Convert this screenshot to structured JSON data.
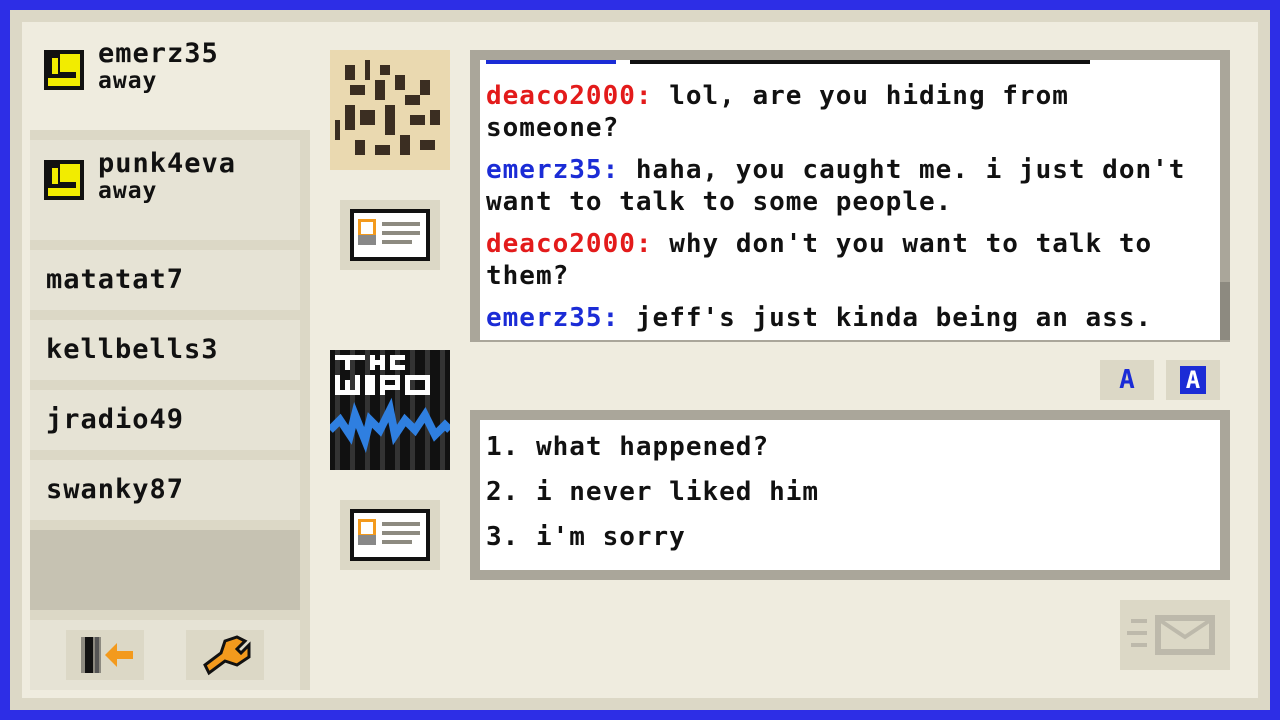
{
  "buddies": [
    {
      "name": "emerz35",
      "status": "away",
      "selected": true
    },
    {
      "name": "punk4eva",
      "status": "away",
      "selected": false
    },
    {
      "name": "matatat7"
    },
    {
      "name": "kellbells3"
    },
    {
      "name": "jradio49"
    },
    {
      "name": "swanky87"
    }
  ],
  "sidebar_buttons": {
    "logout_icon": "sign-off-icon",
    "settings_icon": "wrench-icon"
  },
  "chat_log": [
    {
      "user": "deaco2000:",
      "text": " lol, are you hiding from someone?",
      "color": "#e31b1b"
    },
    {
      "user": "emerz35:",
      "text": " haha, you caught me. i just don't want to talk to some people.",
      "color": "#1b2cd6"
    },
    {
      "user": "deaco2000:",
      "text": " why don't you want to talk to them?",
      "color": "#e31b1b"
    },
    {
      "user": "emerz35:",
      "text": " jeff's just kinda being an ass.",
      "color": "#1b2cd6"
    }
  ],
  "format_buttons": {
    "font": "A",
    "font_color": "A"
  },
  "reply_options": [
    "1. what happened?",
    "2. i never liked him",
    "3. i'm sorry"
  ],
  "colors": {
    "border": "#2d2ee6",
    "away_icon": "#f2ec00",
    "action_icon": "#f39a1d"
  }
}
